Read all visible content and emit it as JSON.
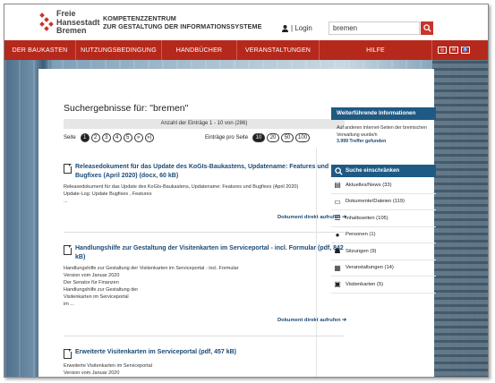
{
  "header": {
    "logo_lines": [
      "Freie",
      "Hansestadt",
      "Bremen"
    ],
    "competence_lines": [
      "KOMPETENZZENTRUM",
      "ZUR GESTALTUNG DER INFORMATIONSSYSTEME"
    ],
    "login_label": "| Login",
    "search_value": "bremen"
  },
  "nav": {
    "items": [
      "DER BAUKASTEN",
      "NUTZUNGSBEDINGUNG",
      "HANDBÜCHER",
      "VERANSTALTUNGEN",
      "HILFE"
    ],
    "icons": [
      "rss-icon",
      "mail-icon",
      "accessibility-icon"
    ]
  },
  "results": {
    "title": "Suchergebnisse für: \"bremen\"",
    "count_text": "Anzahl der Einträge 1 - 10 von (286)",
    "page_label": "Seite",
    "pages": [
      "1",
      "2",
      "3",
      "4",
      "5",
      "»",
      "»|"
    ],
    "per_page_label": "Einträge pro Seite",
    "per_page_options": [
      "10",
      "20",
      "50",
      "100"
    ],
    "items": [
      {
        "title": "Releasedokument für das Update des KoGIs-Baukastens, Updatename: Features und Bugfixes (April 2020) (docx, 60 kB)",
        "body": [
          "Releasedokument für das Update des KoGIs-Baukastens, Updatename: Features und Bugfixes (April 2020)",
          "Update-Log: Update Bugfixes , Features",
          "..."
        ],
        "link": "Dokument direkt aufrufen"
      },
      {
        "title": "Handlungshilfe zur Gestaltung der Visitenkarten im Serviceportal - incl. Formular (pdf, 842 kB)",
        "body": [
          "Handlungshilfe zur Gestaltung der Visitenkarten im Serviceportal - incl. Formular",
          "Version vom Januar 2020",
          "Der Senator für Finanzen",
          "Handlungshilfe zur Gestaltung der",
          "Visitenkarten im Serviceportal",
          "im ..."
        ],
        "link": "Dokument direkt aufrufen"
      },
      {
        "title": "Erweiterte Visitenkarten im Serviceportal (pdf, 457 kB)",
        "body": [
          "Erweiterte Visitenkarten im Serviceportal",
          "Version vom Januar 2020"
        ],
        "link": ""
      }
    ]
  },
  "sidebar": {
    "info_title": "Weiterführende Informationen",
    "info_text": "Auf anderen Internet-Seiten der bremischen Verwaltung wurde/n",
    "info_hits": "3.999 Treffer gefunden",
    "filter_title": "Suche einschränken",
    "filters": [
      {
        "label": "Aktuelles/News (33)",
        "icon": "news-icon"
      },
      {
        "label": "Dokumente/Dateien (119)",
        "icon": "document-icon"
      },
      {
        "label": "Inhaltsseiten (105)",
        "icon": "page-icon"
      },
      {
        "label": "Personen (1)",
        "icon": "person-icon"
      },
      {
        "label": "Sitzungen (9)",
        "icon": "meeting-icon"
      },
      {
        "label": "Veranstaltungen (14)",
        "icon": "calendar-icon"
      },
      {
        "label": "Visitenkarten (5)",
        "icon": "card-icon"
      }
    ]
  },
  "colors": {
    "brand_red": "#b5291d",
    "accent_blue": "#1f5a84",
    "link_blue": "#1a4a76"
  }
}
